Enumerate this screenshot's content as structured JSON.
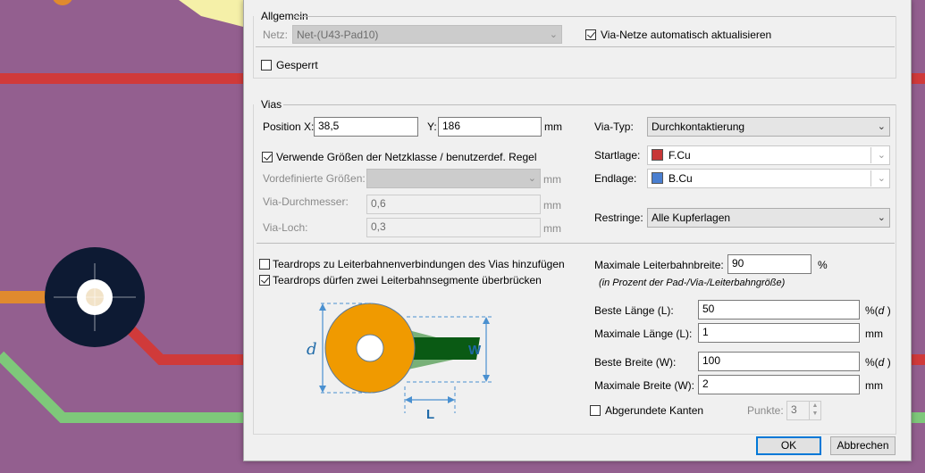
{
  "colors": {
    "board": "#935f8f",
    "track_red": "#d03a3a",
    "track_green": "#7ec87a",
    "track_orange": "#e08a2e",
    "via_dark": "#0d1a33",
    "copper_fcu": "#c83737",
    "copper_bcu": "#4a7fd0",
    "accent": "#0078d7"
  },
  "general": {
    "section": "Allgemein",
    "net_label": "Netz:",
    "net_value": "Net-(U43-Pad10)",
    "auto_update": "Via-Netze automatisch aktualisieren",
    "locked": "Gesperrt"
  },
  "vias": {
    "section": "Vias",
    "pos_x_label": "Position X:",
    "pos_x": "38,5",
    "pos_y_label": "Y:",
    "pos_y": "186",
    "unit": "mm",
    "use_netclass": "Verwende Größen der Netzklasse / benutzerdef. Regel",
    "predefined_label": "Vordefinierte Größen:",
    "predefined_value": "",
    "diameter_label": "Via-Durchmesser:",
    "diameter": "0,6",
    "hole_label": "Via-Loch:",
    "hole": "0,3",
    "type_label": "Via-Typ:",
    "type_value": "Durchkontaktierung",
    "start_label": "Startlage:",
    "start_value": "F.Cu",
    "end_label": "Endlage:",
    "end_value": "B.Cu",
    "annular_label": "Restringe:",
    "annular_value": "Alle Kupferlagen"
  },
  "teardrops": {
    "add": "Teardrops zu Leiterbahnenverbindungen des Vias hinzufügen",
    "bridge": "Teardrops dürfen zwei Leiterbahnsegmente überbrücken",
    "diagram_d": "d",
    "diagram_w": "W",
    "diagram_l": "L",
    "max_width_label": "Maximale Leiterbahnbreite:",
    "max_width": "90",
    "max_width_unit": "%",
    "max_width_hint": "(in Prozent der Pad-/Via-/Leiterbahngröße)",
    "best_len_label": "Beste Länge (L):",
    "best_len": "50",
    "pct_d_unit": "%(",
    "pct_d_var": "d",
    "pct_d_close": " )",
    "max_len_label": "Maximale Länge (L):",
    "max_len": "1",
    "best_w_label": "Beste Breite (W):",
    "best_w": "100",
    "max_w_label": "Maximale Breite (W):",
    "max_w": "2",
    "mm": "mm",
    "rounded": "Abgerundete Kanten",
    "points_label": "Punkte:",
    "points": "3"
  },
  "buttons": {
    "ok": "OK",
    "cancel": "Abbrechen"
  }
}
